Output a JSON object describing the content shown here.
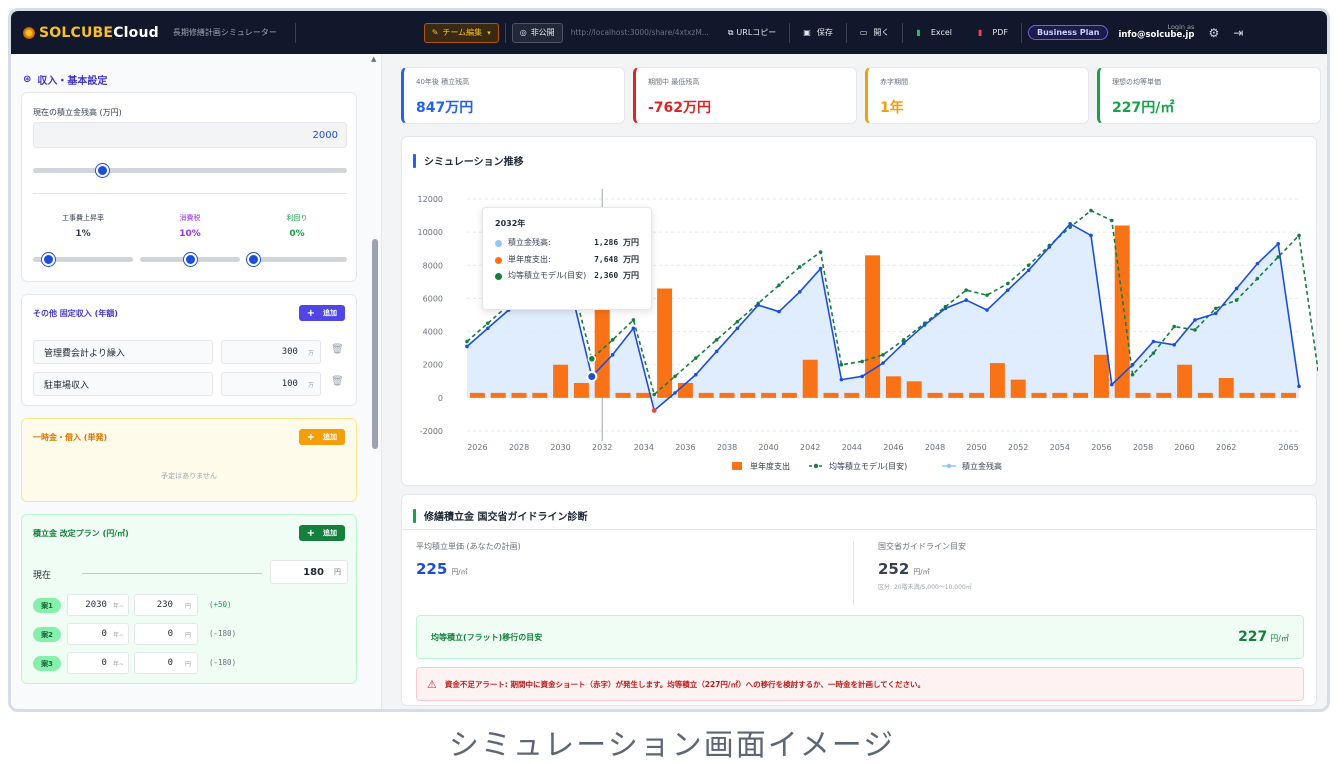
{
  "topbar": {
    "logo_text_a": "SOLCUBE",
    "logo_text_b": "Cloud",
    "app_subtitle": "長期修繕計画シミュレーター",
    "team_edit": "チーム編集",
    "visibility": "非公開",
    "share_url": "http://localhost:3000/share/4xtxzM...",
    "copy_url": "URLコピー",
    "save": "保存",
    "open": "開く",
    "excel": "Excel",
    "pdf": "PDF",
    "plan": "Business Plan",
    "login_label": "Login as",
    "login_email": "info@solcube.jp"
  },
  "left": {
    "section_title": "収入・基本設定",
    "balance_label": "現在の積立金残高 (万円)",
    "balance_value": "2000",
    "balance_slider": 0.21,
    "rate_labels": {
      "cost": "工事費上昇率",
      "tax": "消費税",
      "interest": "利回り"
    },
    "rate_values": {
      "cost": "1%",
      "tax": "10%",
      "interest": "0%"
    },
    "rate_sliders": {
      "cost": 0.1,
      "tax": 0.5,
      "interest": 0.0
    },
    "fixed_income": {
      "title": "その他 固定収入 (年額)",
      "add": "追加",
      "unit": "万",
      "rows": [
        {
          "name": "管理費会計より繰入",
          "value": "300"
        },
        {
          "name": "駐車場収入",
          "value": "100"
        }
      ]
    },
    "lump": {
      "title": "一時金・借入 (単発)",
      "add": "追加",
      "empty": "予定はありません"
    },
    "plan": {
      "title": "積立金 改定プラン (円/㎡)",
      "add": "追加",
      "current_label": "現在",
      "current_value": "180",
      "yen": "円",
      "year_unit": "年~",
      "rows": [
        {
          "tag": "案1",
          "year": "2030",
          "price": "230",
          "diff": "(+50)"
        },
        {
          "tag": "案2",
          "year": "0",
          "price": "0",
          "diff": "(-180)"
        },
        {
          "tag": "案3",
          "year": "0",
          "price": "0",
          "diff": "(-180)"
        }
      ]
    }
  },
  "kpis": [
    {
      "title": "40年後 積立残高",
      "value": "847万円",
      "color": "#2563eb"
    },
    {
      "title": "期間中 最低残高",
      "value": "-762万円",
      "color": "#dc2626"
    },
    {
      "title": "赤字期間",
      "value": "1年",
      "color": "#f59e0b"
    },
    {
      "title": "理想の均等単価",
      "value": "227円/㎡",
      "color": "#16a34a"
    }
  ],
  "chart_title": "シミュレーション推移",
  "tooltip": {
    "year": "2032年",
    "rows": [
      {
        "label": "積立金残高:",
        "value": "1,286 万円",
        "color": "#93c5fd"
      },
      {
        "label": "単年度支出:",
        "value": "7,648 万円",
        "color": "#f97316"
      },
      {
        "label": "均等積立モデル(目安):",
        "value": "2,360 万円",
        "color": "#15803d"
      }
    ]
  },
  "chart_data": {
    "type": "bar",
    "ylim": [
      -2000,
      12000
    ],
    "yticks": [
      -2000,
      0,
      2000,
      4000,
      6000,
      8000,
      10000,
      12000
    ],
    "xticks": [
      "2026",
      "2028",
      "2030",
      "2032",
      "2034",
      "2036",
      "2038",
      "2040",
      "2042",
      "2044",
      "2046",
      "2048",
      "2050",
      "2052",
      "2054",
      "2056",
      "2058",
      "2060",
      "2062",
      "2065"
    ],
    "years": [
      2026,
      2027,
      2028,
      2029,
      2030,
      2031,
      2032,
      2033,
      2034,
      2035,
      2036,
      2037,
      2038,
      2039,
      2040,
      2041,
      2042,
      2043,
      2044,
      2045,
      2046,
      2047,
      2048,
      2049,
      2050,
      2051,
      2052,
      2053,
      2054,
      2055,
      2056,
      2057,
      2058,
      2059,
      2060,
      2061,
      2062,
      2063,
      2064,
      2065
    ],
    "legend": [
      "単年度支出",
      "均等積立モデル(目安)",
      "積立金残高"
    ],
    "series": [
      {
        "name": "単年度支出",
        "type": "bar",
        "color": "#f97316",
        "values": [
          300,
          300,
          300,
          300,
          2000,
          900,
          7648,
          300,
          300,
          6600,
          900,
          300,
          300,
          300,
          300,
          300,
          2300,
          300,
          300,
          8600,
          1300,
          1000,
          300,
          300,
          300,
          2100,
          1100,
          300,
          300,
          300,
          2600,
          10400,
          300,
          300,
          2000,
          300,
          1200,
          300,
          300,
          300
        ]
      },
      {
        "name": "均等積立モデル(目安)",
        "type": "line",
        "color": "#15803d",
        "values": [
          3400,
          4500,
          5600,
          6700,
          7000,
          7200,
          2360,
          3500,
          4700,
          200,
          1300,
          2400,
          3500,
          4600,
          5700,
          6800,
          7900,
          8800,
          2000,
          2200,
          2600,
          3500,
          4500,
          5500,
          6500,
          6200,
          6900,
          8000,
          9200,
          10300,
          11300,
          10700,
          1400,
          2700,
          4300,
          4100,
          5400,
          5900,
          7200,
          8500,
          9800,
          900
        ]
      },
      {
        "name": "積立金残高",
        "type": "line",
        "color": "#1d4ed8",
        "values": [
          3100,
          4200,
          5300,
          6300,
          6600,
          6500,
          1286,
          2600,
          4200,
          -762,
          300,
          1400,
          2800,
          4200,
          5600,
          5200,
          6400,
          7800,
          1100,
          1300,
          2100,
          3300,
          4400,
          5400,
          5900,
          5300,
          6500,
          7700,
          9100,
          10500,
          9800,
          800,
          2000,
          3400,
          3200,
          4700,
          5100,
          6600,
          8100,
          9300,
          700
        ]
      }
    ]
  },
  "guideline": {
    "title": "修繕積立金 国交省ガイドライン診断",
    "yours_label": "平均積立単価 (あなたの計画)",
    "yours_value": "225",
    "yours_unit": "円/㎡",
    "guide_label": "国交省ガイドライン目安",
    "guide_value": "252",
    "guide_unit": "円/㎡",
    "guide_note": "区分: 20階未満/5,000〜10,000㎡",
    "flat_label": "均等積立(フラット)移行の目安",
    "flat_value": "227",
    "flat_unit": "円/㎡",
    "alert": "資金不足アラート: 期間中に資金ショート（赤字）が発生します。均等積立（227円/㎡）への移行を検討するか、一時金を計画してください。"
  },
  "caption": "シミュレーション画面イメージ"
}
